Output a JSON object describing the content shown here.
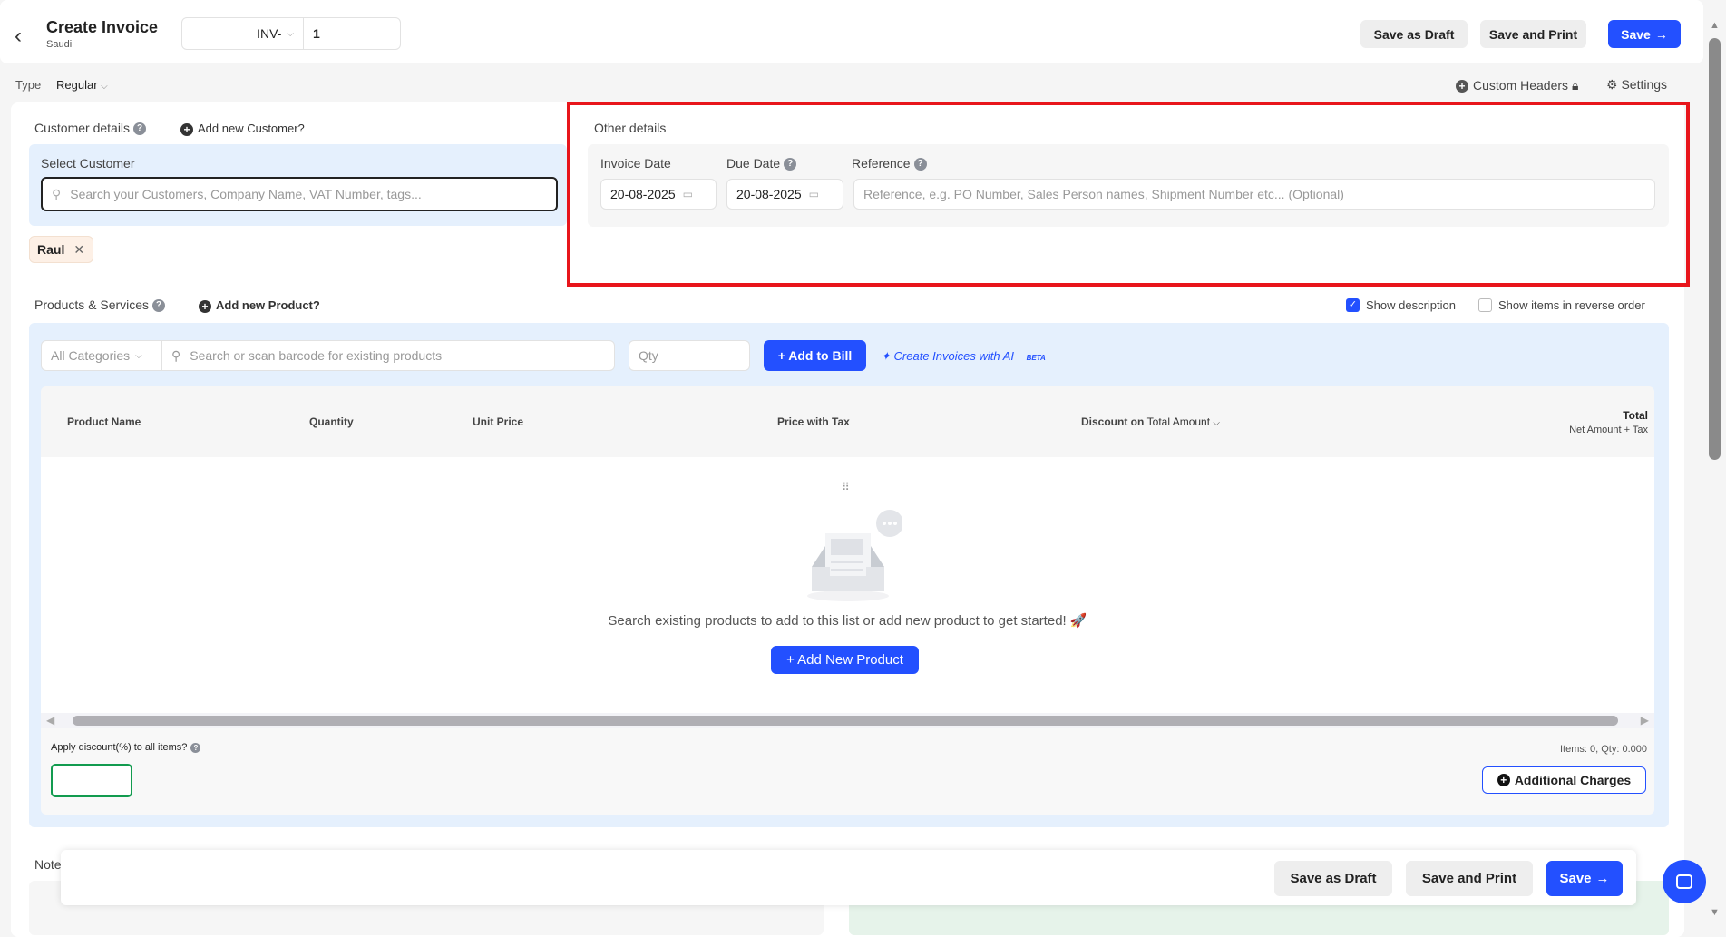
{
  "header": {
    "title": "Create Invoice",
    "subtitle": "Saudi",
    "prefix": "INV-",
    "number": "1",
    "save_draft": "Save as Draft",
    "save_print": "Save and Print",
    "save": "Save"
  },
  "type_row": {
    "label": "Type",
    "value": "Regular",
    "custom_headers": "Custom Headers",
    "settings": "Settings"
  },
  "customer": {
    "title": "Customer details",
    "add_new": "Add new Customer?",
    "select_label": "Select Customer",
    "search_placeholder": "Search your Customers, Company Name, VAT Number, tags...",
    "selected": "Raul"
  },
  "other": {
    "title": "Other details",
    "invoice_date_label": "Invoice Date",
    "invoice_date": "20-08-2025",
    "due_date_label": "Due Date",
    "due_date": "20-08-2025",
    "reference_label": "Reference",
    "reference_placeholder": "Reference, e.g. PO Number, Sales Person names, Shipment Number etc... (Optional)"
  },
  "products": {
    "title": "Products & Services",
    "add_new": "Add new Product?",
    "show_description": "Show description",
    "show_description_checked": true,
    "reverse_order": "Show items in reverse order",
    "reverse_order_checked": false,
    "categories": "All Categories",
    "search_placeholder": "Search or scan barcode for existing products",
    "qty_placeholder": "Qty",
    "add_to_bill": "+ Add to Bill",
    "ai_label": "Create Invoices with AI",
    "ai_badge": "BETA",
    "columns": {
      "name": "Product Name",
      "quantity": "Quantity",
      "unit_price": "Unit Price",
      "price_tax": "Price with Tax",
      "discount_on": "Discount on",
      "discount_type": "Total Amount",
      "total": "Total",
      "total_sub": "Net Amount + Tax"
    },
    "empty_text": "Search existing products to add to this list or add new product to get started! 🚀",
    "add_new_product": "+ Add New Product",
    "apply_discount": "Apply discount(%) to all items?",
    "summary": "Items: 0, Qty: 0.000",
    "additional_charges": "Additional Charges"
  },
  "notes": {
    "label": "Notes"
  },
  "footer": {
    "save_draft": "Save as Draft",
    "save_print": "Save and Print",
    "save": "Save"
  },
  "colors": {
    "accent": "#2350ff",
    "highlight": "#e8151b"
  }
}
